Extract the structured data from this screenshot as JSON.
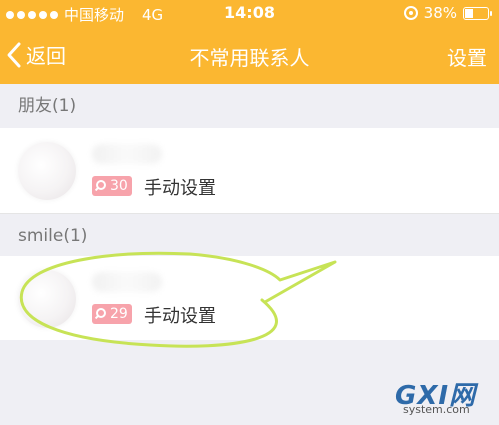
{
  "status_bar": {
    "carrier": "中国移动",
    "network": "4G",
    "time": "14:08",
    "battery": "38%",
    "battery_level": 0.38
  },
  "nav": {
    "back_label": "返回",
    "title": "不常用联系人",
    "settings_label": "设置"
  },
  "sections": [
    {
      "header": "朋友(1)",
      "contacts": [
        {
          "badge_value": "30",
          "status_label": "手动设置"
        }
      ]
    },
    {
      "header": "smile(1)",
      "contacts": [
        {
          "badge_value": "29",
          "status_label": "手动设置"
        }
      ]
    }
  ],
  "watermark": {
    "main": "GXI网",
    "sub": "system.com"
  },
  "colors": {
    "accent": "#fbb731",
    "badge": "#f7a3ab",
    "annotation": "#c7e356"
  }
}
